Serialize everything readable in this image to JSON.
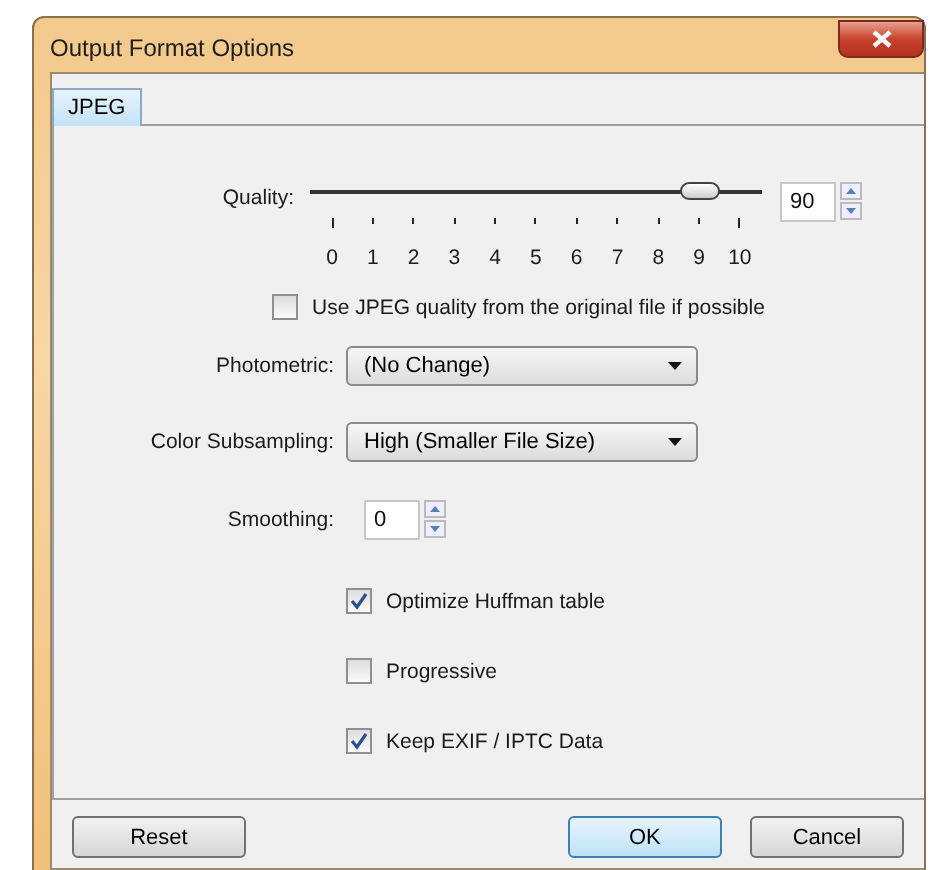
{
  "window": {
    "title": "Output Format Options"
  },
  "tabs": [
    {
      "label": "JPEG",
      "selected": true
    }
  ],
  "quality": {
    "label": "Quality:",
    "level": 0.9,
    "ticks": [
      "0",
      "1",
      "2",
      "3",
      "4",
      "5",
      "6",
      "7",
      "8",
      "9",
      "10"
    ],
    "value": "90"
  },
  "use_original_quality": {
    "label": "Use JPEG quality from the original file if possible",
    "checked": false
  },
  "dropdowns": [
    {
      "label": "Photometric:",
      "value": "(No Change)"
    },
    {
      "label": "Color Subsampling:",
      "value": "High (Smaller File Size)"
    }
  ],
  "smoothing": {
    "label": "Smoothing:",
    "value": "0"
  },
  "options": [
    {
      "label": "Optimize Huffman table",
      "checked": true
    },
    {
      "label": "Progressive",
      "checked": false
    },
    {
      "label": "Keep EXIF / IPTC Data",
      "checked": true
    }
  ],
  "buttons": [
    {
      "label": "Reset",
      "kind": "left",
      "default": false
    },
    {
      "label": "OK",
      "kind": "right",
      "default": true
    },
    {
      "label": "Cancel",
      "kind": "right",
      "default": false
    }
  ]
}
